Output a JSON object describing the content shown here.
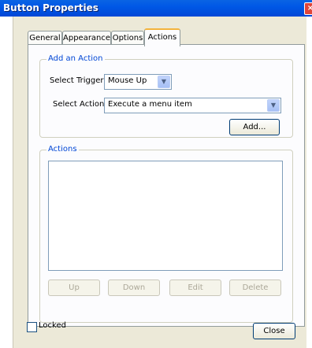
{
  "window": {
    "title": "Button Properties",
    "close_glyph": "×"
  },
  "tabs": [
    "General",
    "Appearance",
    "Options",
    "Actions"
  ],
  "active_tab": "Actions",
  "add_action": {
    "legend": "Add an Action",
    "trigger_label": "Select Trigger:",
    "trigger_value": "Mouse Up",
    "action_label": "Select Action:",
    "action_value": "Execute a menu item",
    "add_button": "Add..."
  },
  "actions": {
    "legend": "Actions",
    "buttons": {
      "up": "Up",
      "down": "Down",
      "edit": "Edit",
      "delete": "Delete"
    }
  },
  "footer": {
    "locked_label": "Locked",
    "locked_checked": false,
    "close_button": "Close"
  },
  "icons": {
    "dropdown_arrow": "chevron-down-icon"
  },
  "colors": {
    "title_bar": "#0058e6",
    "group_legend": "#0046d5",
    "active_tab_accent": "#f3b33d"
  }
}
